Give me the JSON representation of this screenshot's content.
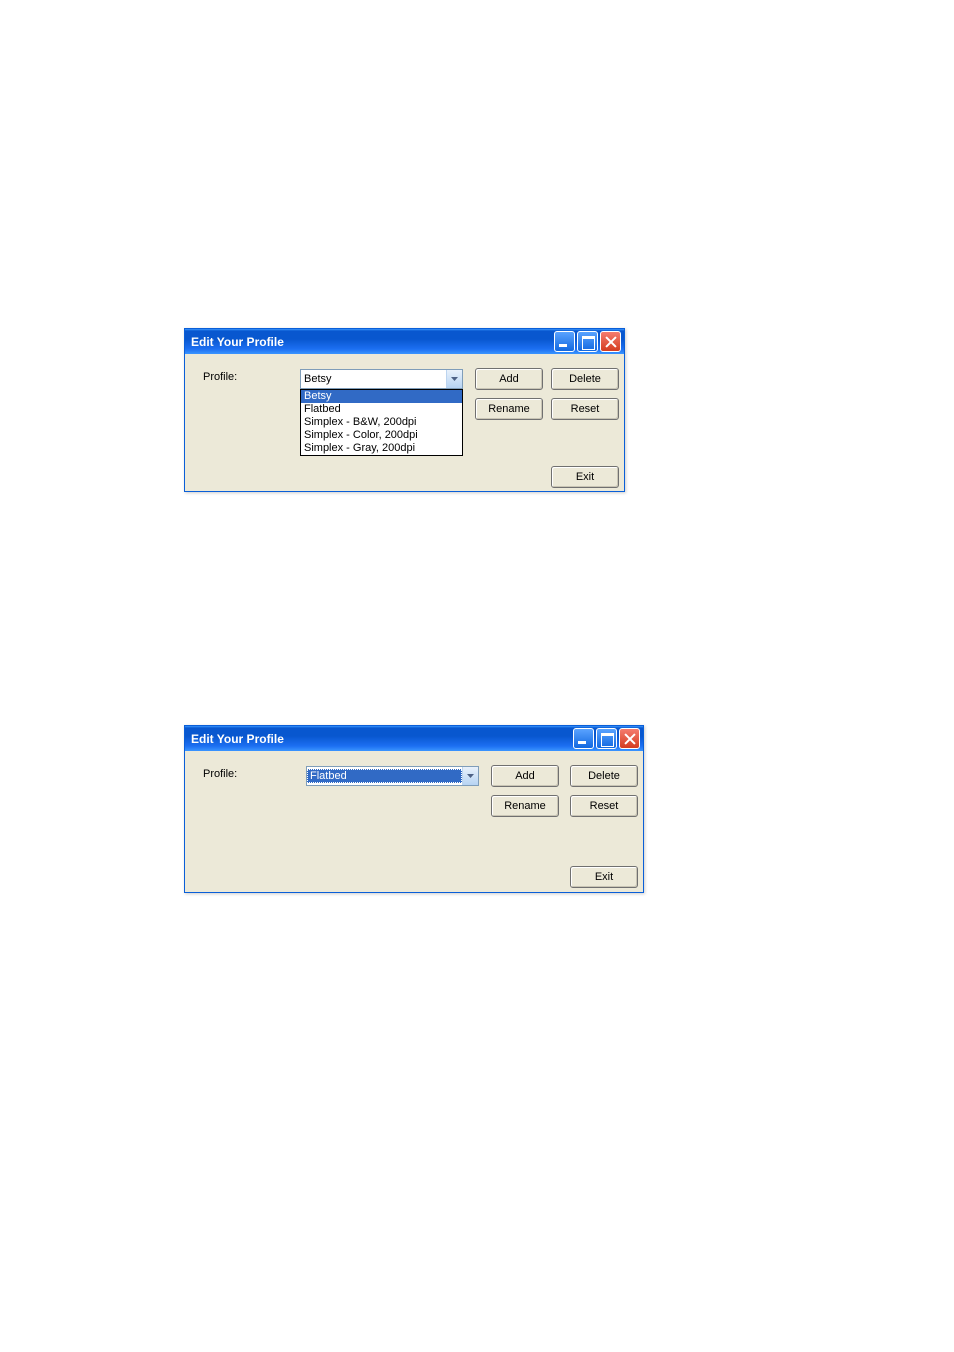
{
  "window1": {
    "title": "Edit Your Profile",
    "profile_label": "Profile:",
    "combo_value": "Betsy",
    "dropdown_items": [
      "Betsy",
      "Flatbed",
      "Simplex - B&W, 200dpi",
      "Simplex - Color, 200dpi",
      "Simplex - Gray, 200dpi"
    ],
    "buttons": {
      "add": "Add",
      "delete": "Delete",
      "rename": "Rename",
      "reset": "Reset",
      "exit": "Exit"
    }
  },
  "window2": {
    "title": "Edit Your Profile",
    "profile_label": "Profile:",
    "combo_value": "Flatbed",
    "buttons": {
      "add": "Add",
      "delete": "Delete",
      "rename": "Rename",
      "reset": "Reset",
      "exit": "Exit"
    }
  }
}
